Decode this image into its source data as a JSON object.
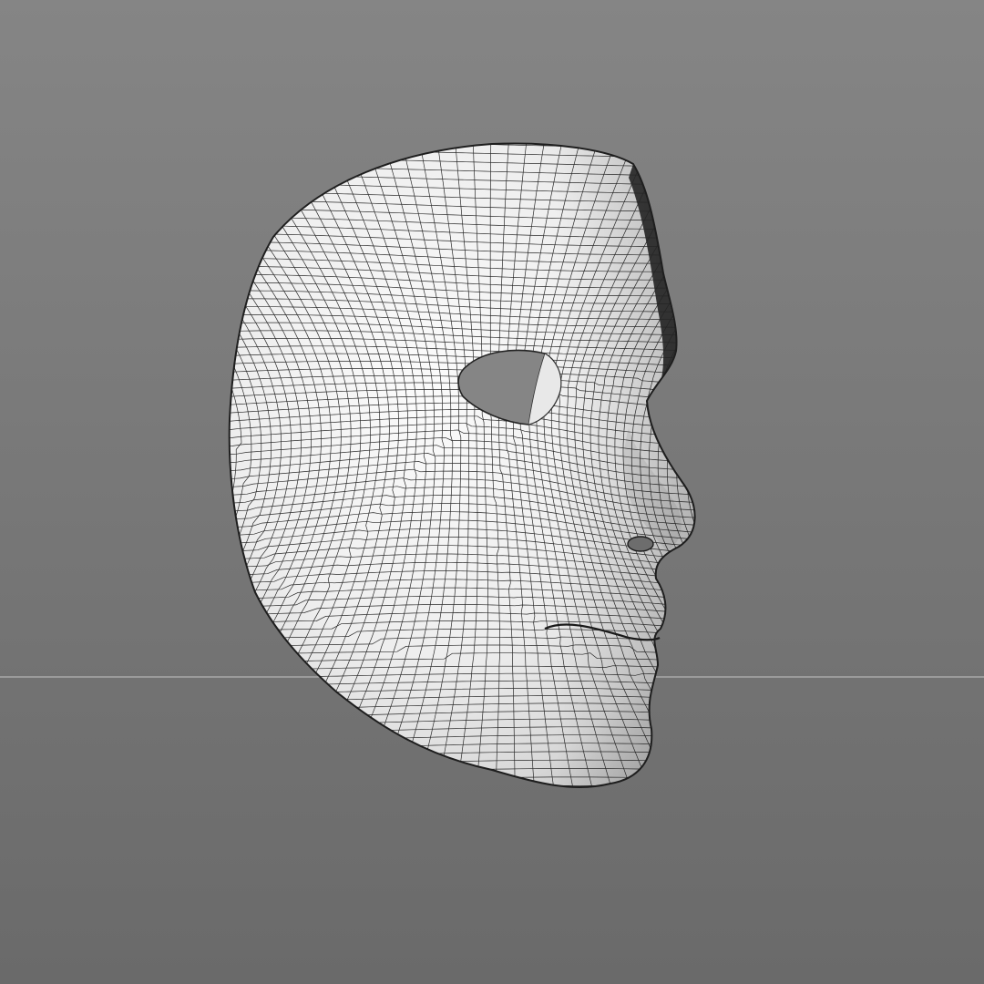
{
  "viewport": {
    "background_top": "#858585",
    "background_bottom": "#6a6a6a",
    "horizon_line_color": "#c4c4c4"
  },
  "model": {
    "subject": "face mask",
    "render_style": "wireframe-over-shaded",
    "surface_color": "#f2f2f2",
    "wire_color": "#2a2a2a",
    "shadow_color": "#9a9a9a"
  }
}
